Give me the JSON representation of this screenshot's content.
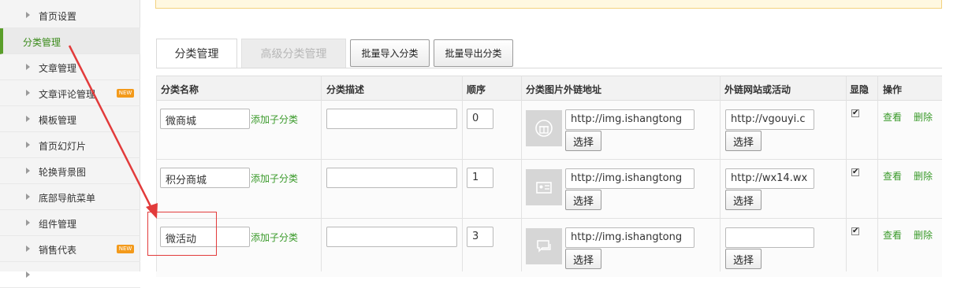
{
  "sidebar": {
    "items": [
      {
        "label": "首页设置"
      },
      {
        "label": "分类管理"
      },
      {
        "label": "文章管理"
      },
      {
        "label": "文章评论管理",
        "badge": "NEW"
      },
      {
        "label": "模板管理"
      },
      {
        "label": "首页幻灯片"
      },
      {
        "label": "轮换背景图"
      },
      {
        "label": "底部导航菜单"
      },
      {
        "label": "组件管理"
      },
      {
        "label": "销售代表",
        "badge": "NEW"
      }
    ]
  },
  "tabs": {
    "active": "分类管理",
    "disabled": "高级分类管理",
    "import_label": "批量导入分类",
    "export_label": "批量导出分类"
  },
  "table": {
    "headers": [
      "分类名称",
      "分类描述",
      "顺序",
      "分类图片外链地址",
      "外链网站或活动",
      "显隐",
      "操作"
    ],
    "add_sub_label": "添加子分类",
    "select_label": "选择",
    "view_label": "查看",
    "delete_label": "删除",
    "rows": [
      {
        "name": "微商城",
        "desc": "",
        "order": "0",
        "img_url": "http://img.ishangtong",
        "link": "http://vgouyi.c",
        "thumb_icon": "gift-icon",
        "visible": true
      },
      {
        "name": "积分商城",
        "desc": "",
        "order": "1",
        "img_url": "http://img.ishangtong",
        "link": "http://wx14.wx",
        "thumb_icon": "id-card-icon",
        "visible": true
      },
      {
        "name": "微活动",
        "desc": "",
        "order": "3",
        "img_url": "http://img.ishangtong",
        "link": "",
        "thumb_icon": "chat-icon",
        "visible": true
      }
    ]
  },
  "colors": {
    "accent_green": "#3a9a2a",
    "annotation_red": "#e23b3b",
    "badge_orange": "#f39a1b"
  }
}
